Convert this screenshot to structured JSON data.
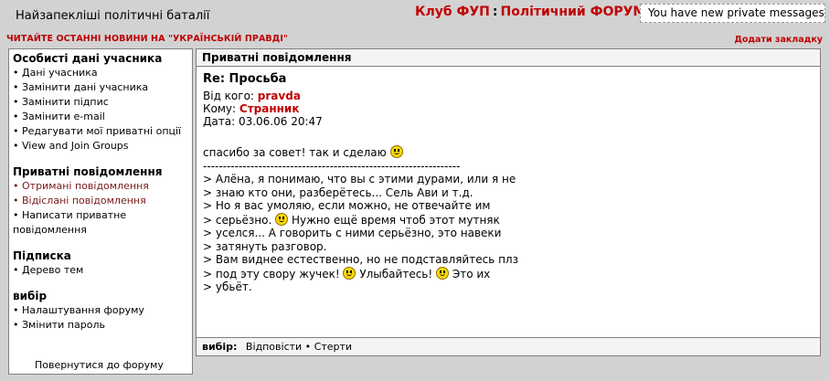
{
  "header": {
    "forum_title": "Найзапекліші політичні баталії",
    "site_part1": "Клуб ФУП",
    "site_sep": ":",
    "site_part2": "Політичний ФОРУМ",
    "pm_notice": "You have new private messages",
    "news_link": "ЧИТАЙТЕ ОСТАННІ НОВИНИ НА \"УКРАЇНСЬКІЙ ПРАВДІ\"",
    "bookmark_link": "Додати закладку"
  },
  "sidebar": {
    "personal": {
      "heading": "Особисті дані учасника",
      "items": [
        "Дані учасника",
        "Замінити дані учасника",
        "Замінити підпис",
        "Замінити e-mail",
        "Редагувати мої приватні опції",
        "View and Join Groups"
      ]
    },
    "private": {
      "heading": "Приватні повідомлення",
      "items": [
        "Отримані повідомлення",
        "Відіслані повідомлення",
        "Написати приватне повідомлення"
      ]
    },
    "subscription": {
      "heading": "Підписка",
      "items": [
        "Дерево тем"
      ]
    },
    "choice": {
      "heading": "вибір",
      "items": [
        "Налаштування форуму",
        "Змінити пароль"
      ]
    },
    "back_link": "Повернутися до форуму"
  },
  "main": {
    "header": "Приватні повідомлення",
    "subject": "Re: Просьба",
    "from_label": "Від кого:",
    "from_name": "pravda",
    "to_label": "Кому:",
    "to_name": "Странник",
    "date_label": "Дата:",
    "date_value": "03.06.06 20:47",
    "line1": "спасибо за совет! так и сделаю",
    "separator": "-----------------------------------------------------------------",
    "quote": [
      "> Алёна, я понимаю, что вы с этими дурами, или я не",
      "> знаю кто они, разберётесь... Сель Ави и т.д.",
      "> Но я вас умоляю, если можно, не отвечайте им",
      "> серьёзно.",
      "Нужно ещё время чтоб этот мутняк",
      "> уселся... А говорить с ними серьёзно, это навеки",
      "> затянуть разговор.",
      "> Вам виднее естественно, но не подставляйтесь плз",
      "> под эту свору жучек!",
      "Улыбайтесь!",
      "Это их",
      "> убьёт."
    ]
  },
  "actions": {
    "label": "вибір:",
    "reply": "Відповісти",
    "delete": "Стерти"
  }
}
